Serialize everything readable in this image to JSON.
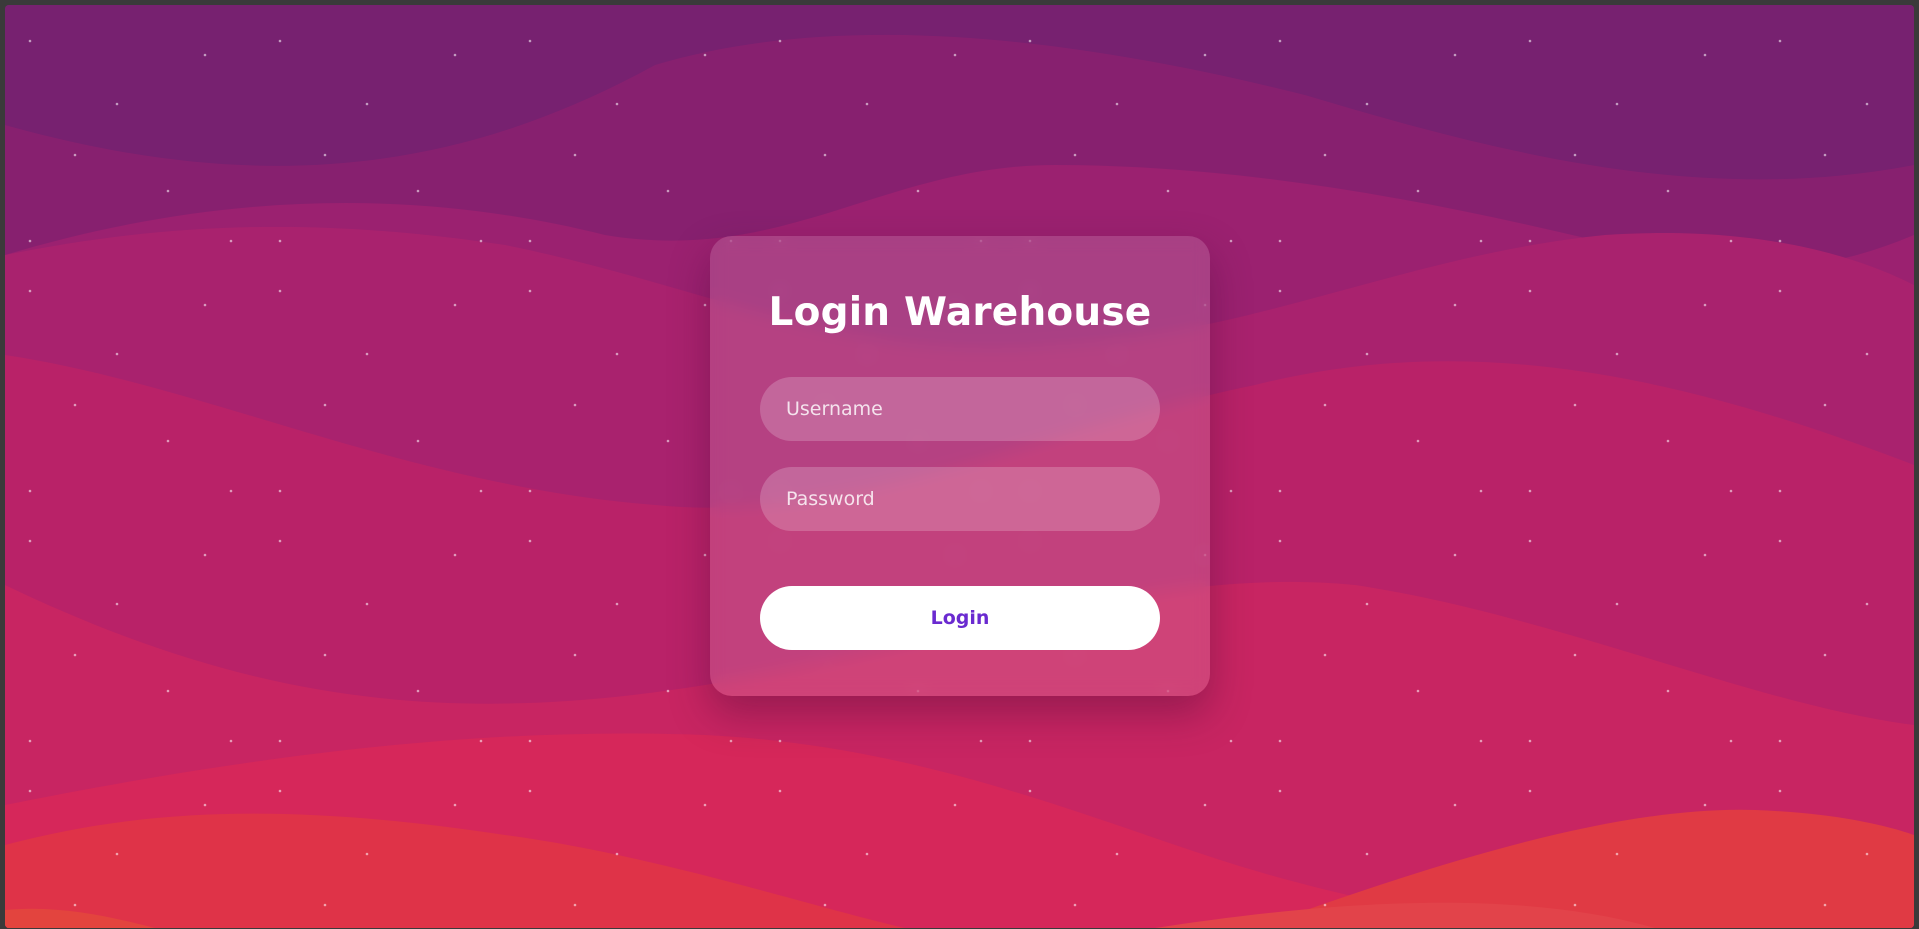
{
  "login": {
    "title": "Login Warehouse",
    "username_placeholder": "Username",
    "username_value": "",
    "password_placeholder": "Password",
    "password_value": "",
    "button_label": "Login"
  },
  "theme": {
    "button_text_color": "#6a2ad0",
    "background_top": "#7a2270",
    "background_bottom": "#e03a44"
  }
}
